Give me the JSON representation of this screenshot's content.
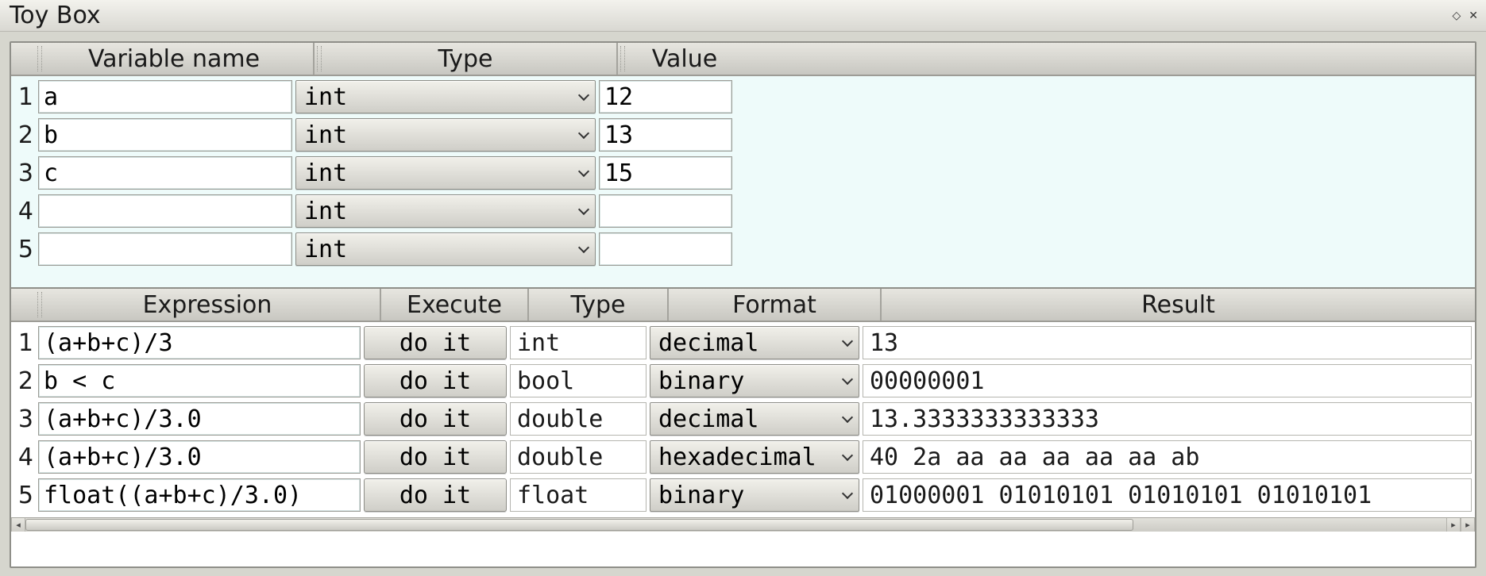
{
  "window": {
    "title": "Toy Box"
  },
  "vars_panel": {
    "headers": {
      "rownum": "",
      "name": "Variable name",
      "type": "Type",
      "value": "Value"
    },
    "rows": [
      {
        "num": "1",
        "name": "a",
        "type": "int",
        "value": "12"
      },
      {
        "num": "2",
        "name": "b",
        "type": "int",
        "value": "13"
      },
      {
        "num": "3",
        "name": "c",
        "type": "int",
        "value": "15"
      },
      {
        "num": "4",
        "name": "",
        "type": "int",
        "value": ""
      },
      {
        "num": "5",
        "name": "",
        "type": "int",
        "value": ""
      }
    ]
  },
  "expr_panel": {
    "headers": {
      "rownum": "",
      "expr": "Expression",
      "exec": "Execute",
      "type": "Type",
      "format": "Format",
      "result": "Result"
    },
    "exec_label": "do it",
    "rows": [
      {
        "num": "1",
        "expr": "(a+b+c)/3",
        "type": "int",
        "format": "decimal",
        "result": "13"
      },
      {
        "num": "2",
        "expr": "b < c",
        "type": "bool",
        "format": "binary",
        "result": "00000001"
      },
      {
        "num": "3",
        "expr": "(a+b+c)/3.0",
        "type": "double",
        "format": "decimal",
        "result": "13.3333333333333"
      },
      {
        "num": "4",
        "expr": "(a+b+c)/3.0",
        "type": "double",
        "format": "hexadecimal",
        "result": "40 2a aa aa aa aa aa ab"
      },
      {
        "num": "5",
        "expr": "float((a+b+c)/3.0)",
        "type": "float",
        "format": "binary",
        "result": "01000001 01010101 01010101 01010101"
      }
    ]
  }
}
